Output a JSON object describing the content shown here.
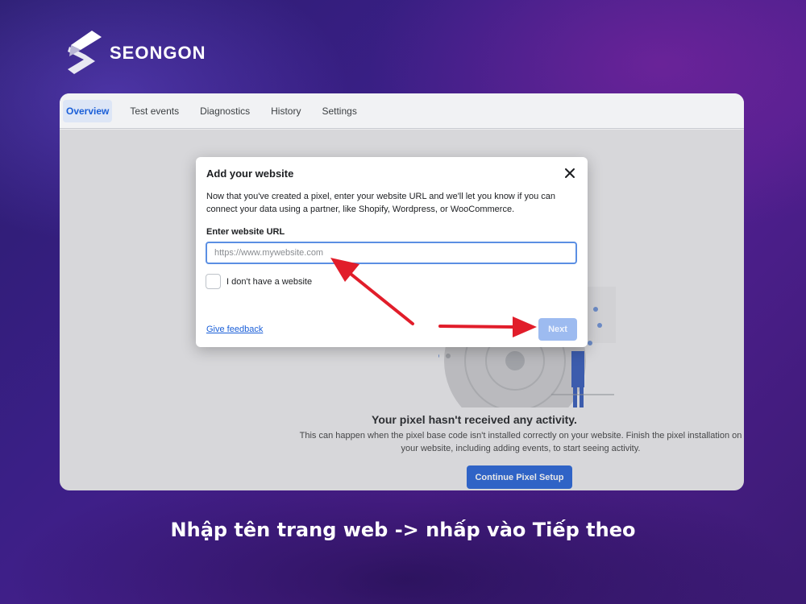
{
  "brand": {
    "name": "SEONGON"
  },
  "tabs": [
    {
      "label": "Overview",
      "active": true
    },
    {
      "label": "Test events",
      "active": false
    },
    {
      "label": "Diagnostics",
      "active": false
    },
    {
      "label": "History",
      "active": false
    },
    {
      "label": "Settings",
      "active": false
    }
  ],
  "empty_state": {
    "title": "Your pixel hasn't received any activity.",
    "description": "This can happen when the pixel base code isn't installed correctly on your website. Finish the pixel installation on your website, including adding events, to start seeing activity.",
    "cta_label": "Continue Pixel Setup"
  },
  "modal": {
    "title": "Add your website",
    "body": "Now that you've created a pixel, enter your website URL and we'll let you know if you can connect your data using a partner, like Shopify, Wordpress, or WooCommerce.",
    "field_label": "Enter website URL",
    "url_value": "",
    "url_placeholder": "https://www.mywebsite.com",
    "checkbox_label": "I don't have a website",
    "checkbox_checked": false,
    "feedback_label": "Give feedback",
    "next_label": "Next"
  },
  "caption": "Nhập tên trang web -> nhấp vào Tiếp theo",
  "colors": {
    "accent": "#1f5fd6",
    "next_disabled": "#9dbbf0",
    "arrow": "#e11d2a",
    "background": "#3a1f86"
  }
}
